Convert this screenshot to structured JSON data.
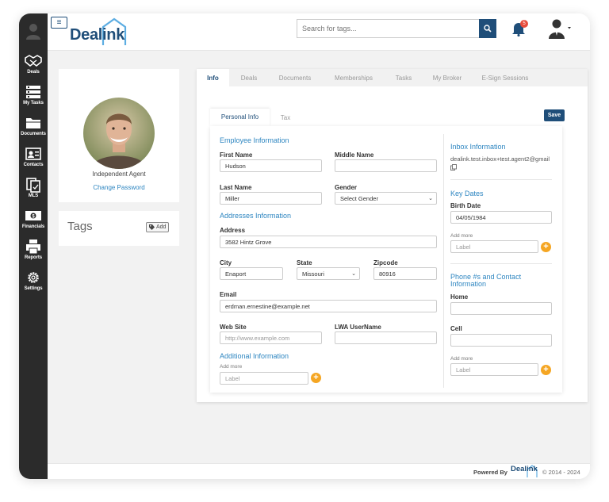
{
  "sidebar": {
    "items": [
      {
        "label": "Deals",
        "icon": "handshake-icon"
      },
      {
        "label": "My Tasks",
        "icon": "tasks-icon"
      },
      {
        "label": "Documents",
        "icon": "folder-icon"
      },
      {
        "label": "Contacts",
        "icon": "contact-card-icon"
      },
      {
        "label": "MLS",
        "icon": "mls-icon"
      },
      {
        "label": "Financials",
        "icon": "money-icon"
      },
      {
        "label": "Reports",
        "icon": "printer-icon"
      },
      {
        "label": "Settings",
        "icon": "gear-icon"
      }
    ]
  },
  "header": {
    "hamburger": "≡",
    "logo": "Dealink",
    "search_placeholder": "Search for tags...",
    "notifications_count": "5"
  },
  "profile": {
    "role": "Independent Agent",
    "change_password": "Change Password"
  },
  "tags": {
    "title": "Tags",
    "add_label": "Add"
  },
  "tabs": [
    "Info",
    "Deals",
    "Documents",
    "Memberships",
    "Tasks",
    "My Broker",
    "E-Sign Sessions"
  ],
  "subtabs": [
    "Personal Info",
    "Tax"
  ],
  "save_label": "Save",
  "form": {
    "employee_info_title": "Employee Information",
    "first_name_label": "First Name",
    "first_name": "Hudson",
    "middle_name_label": "Middle Name",
    "middle_name": "",
    "last_name_label": "Last Name",
    "last_name": "Miller",
    "gender_label": "Gender",
    "gender": "Select Gender",
    "address_info_title": "Addresses Information",
    "address_label": "Address",
    "address": "3582 Hintz Grove",
    "city_label": "City",
    "city": "Enaport",
    "state_label": "State",
    "state": "Missouri",
    "zipcode_label": "Zipcode",
    "zipcode": "80916",
    "email_label": "Email",
    "email": "erdman.ernestine@example.net",
    "website_label": "Web Site",
    "website_placeholder": "http://www.example.com",
    "lwa_label": "LWA UserName",
    "lwa": "",
    "additional_title": "Additional Information",
    "add_more": "Add more",
    "label_placeholder": "Label"
  },
  "right": {
    "inbox_title": "Inbox Information",
    "inbox_email": "dealink.test.inbox+test.agent2@gmail",
    "key_dates_title": "Key Dates",
    "birth_date_label": "Birth Date",
    "birth_date": "04/05/1984",
    "add_more": "Add more",
    "label_placeholder": "Label",
    "phone_title": "Phone #s and Contact Information",
    "home_label": "Home",
    "home": "",
    "cell_label": "Cell",
    "cell": ""
  },
  "footer": {
    "powered_by": "Powered By",
    "logo": "Dealink",
    "copyright": "© 2014 - 2024"
  },
  "colors": {
    "brand": "#1f4e79",
    "accent_link": "#2e86c1",
    "add_button": "#f5a623",
    "badge": "#e74c3c",
    "sidebar": "#2b2b2b"
  }
}
